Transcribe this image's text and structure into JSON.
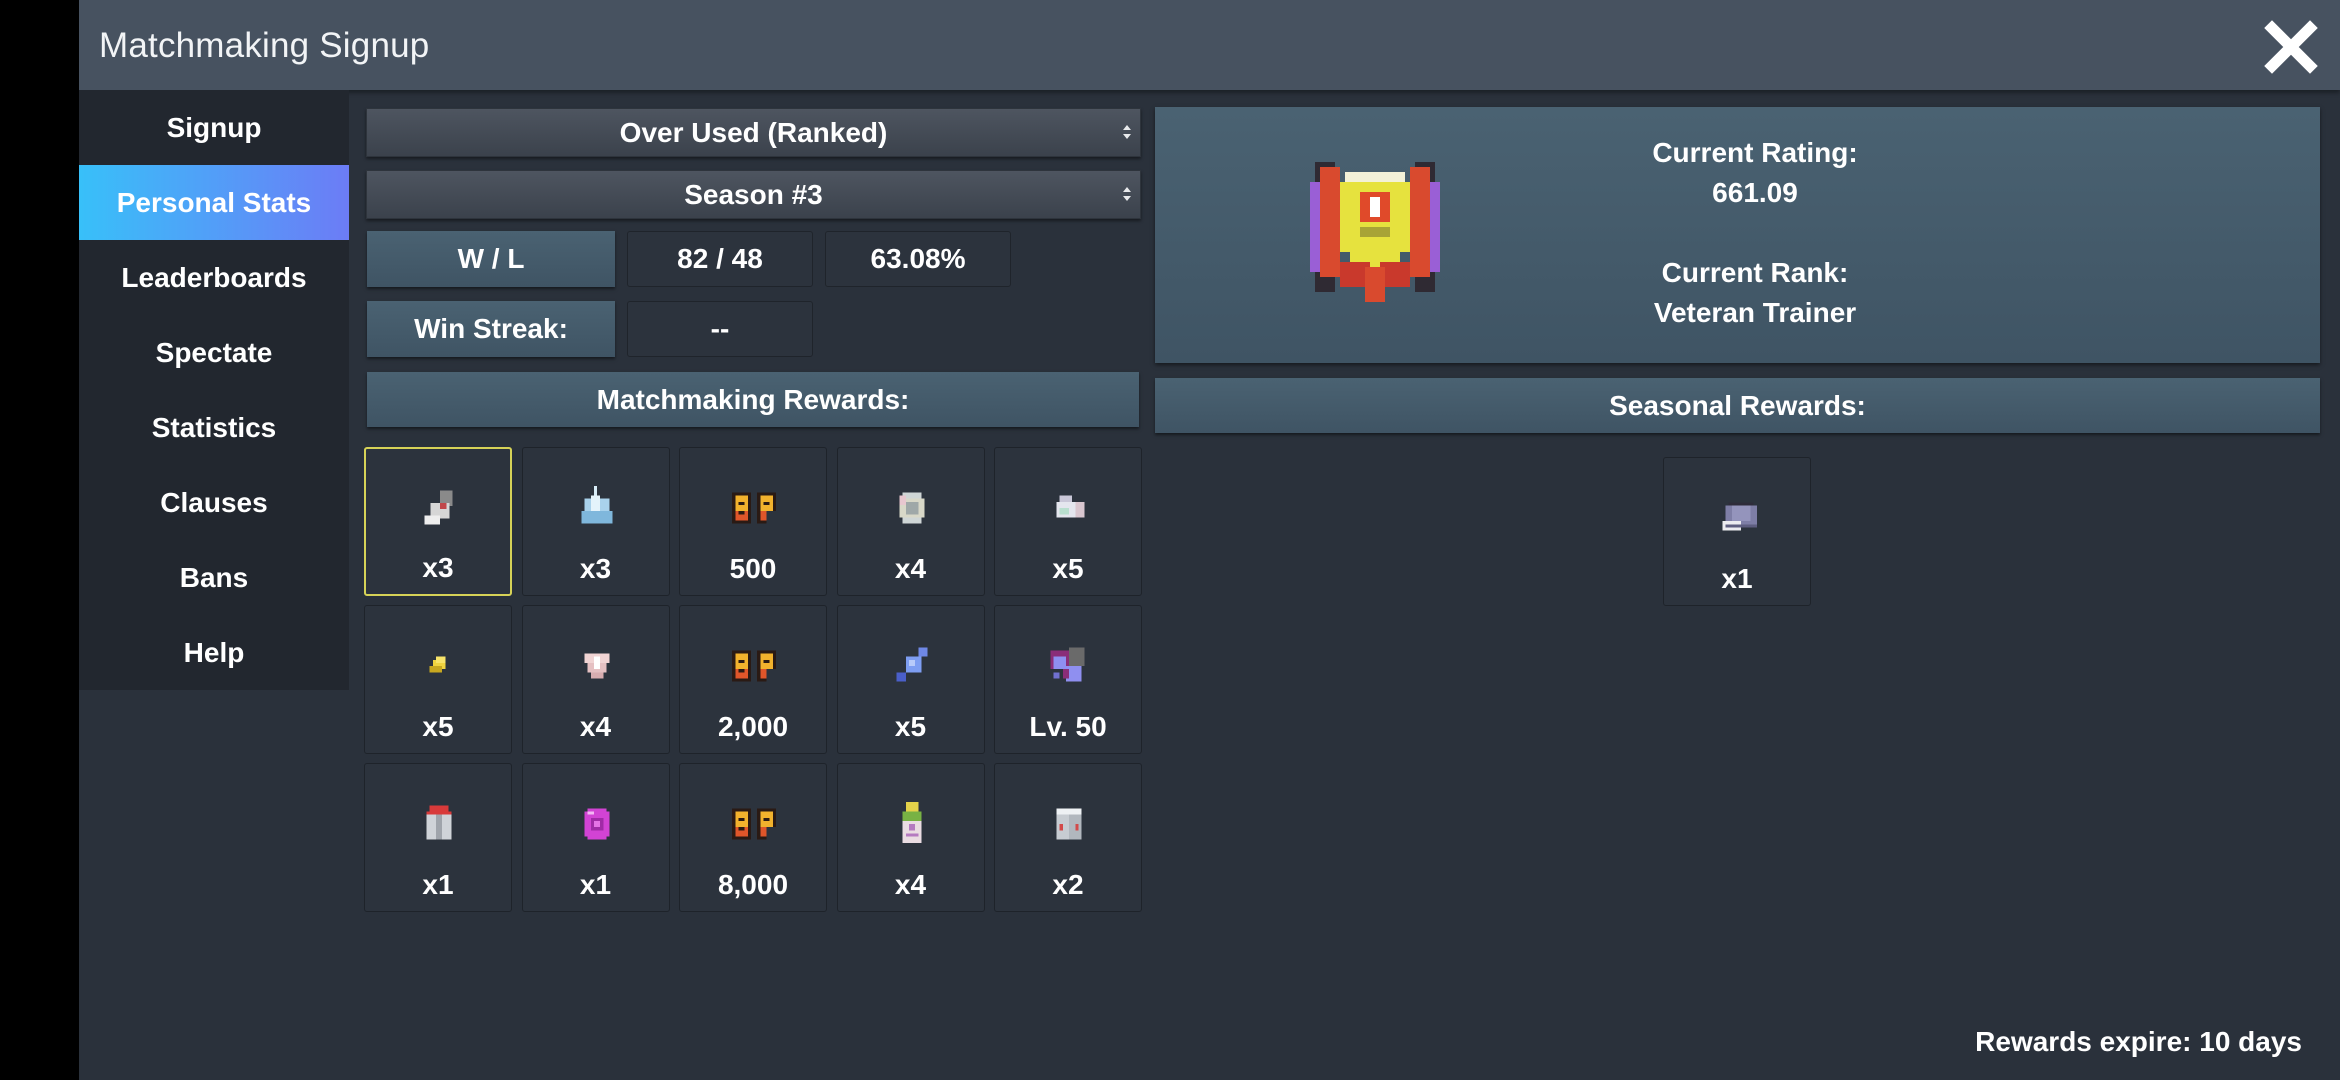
{
  "window": {
    "title": "Matchmaking Signup",
    "close_icon": "close-icon"
  },
  "sidebar": {
    "items": [
      {
        "label": "Signup",
        "active": false
      },
      {
        "label": "Personal Stats",
        "active": true
      },
      {
        "label": "Leaderboards",
        "active": false
      },
      {
        "label": "Spectate",
        "active": false
      },
      {
        "label": "Statistics",
        "active": false
      },
      {
        "label": "Clauses",
        "active": false
      },
      {
        "label": "Bans",
        "active": false
      },
      {
        "label": "Help",
        "active": false
      }
    ]
  },
  "filters": {
    "format": "Over Used (Ranked)",
    "season": "Season #3"
  },
  "stats": {
    "wl_label": "W / L",
    "wl_value": "82 / 48",
    "win_rate": "63.08%",
    "streak_label": "Win Streak:",
    "streak_value": "--"
  },
  "rating": {
    "rating_label": "Current Rating:",
    "rating_value": "661.09",
    "rank_label": "Current Rank:",
    "rank_value": "Veteran Trainer",
    "badge_icon": "rank-badge-icon"
  },
  "matchmaking_rewards": {
    "header": "Matchmaking Rewards:",
    "items": [
      {
        "icon": "ticket-item-icon",
        "qty": "x3",
        "selected": true
      },
      {
        "icon": "ice-crystal-item-icon",
        "qty": "x3"
      },
      {
        "icon": "bp-icon",
        "qty": "500"
      },
      {
        "icon": "rainbow-egg-item-icon",
        "qty": "x4"
      },
      {
        "icon": "shard-item-icon",
        "qty": "x5"
      },
      {
        "icon": "gold-nugget-item-icon",
        "qty": "x5"
      },
      {
        "icon": "pink-gem-item-icon",
        "qty": "x4"
      },
      {
        "icon": "bp-icon",
        "qty": "2,000"
      },
      {
        "icon": "rare-candy-item-icon",
        "qty": "x5"
      },
      {
        "icon": "pokemon-sprite-icon",
        "qty": "Lv. 50"
      },
      {
        "icon": "gift-box-item-icon",
        "qty": "x1"
      },
      {
        "icon": "pink-orb-item-icon",
        "qty": "x1"
      },
      {
        "icon": "bp-icon",
        "qty": "8,000"
      },
      {
        "icon": "potion-bottle-item-icon",
        "qty": "x4"
      },
      {
        "icon": "mystery-box-item-icon",
        "qty": "x2"
      }
    ]
  },
  "seasonal_rewards": {
    "header": "Seasonal Rewards:",
    "items": [
      {
        "icon": "cap-item-icon",
        "qty": "x1"
      }
    ]
  },
  "footer": {
    "expiry": "Rewards expire: 10 days"
  }
}
